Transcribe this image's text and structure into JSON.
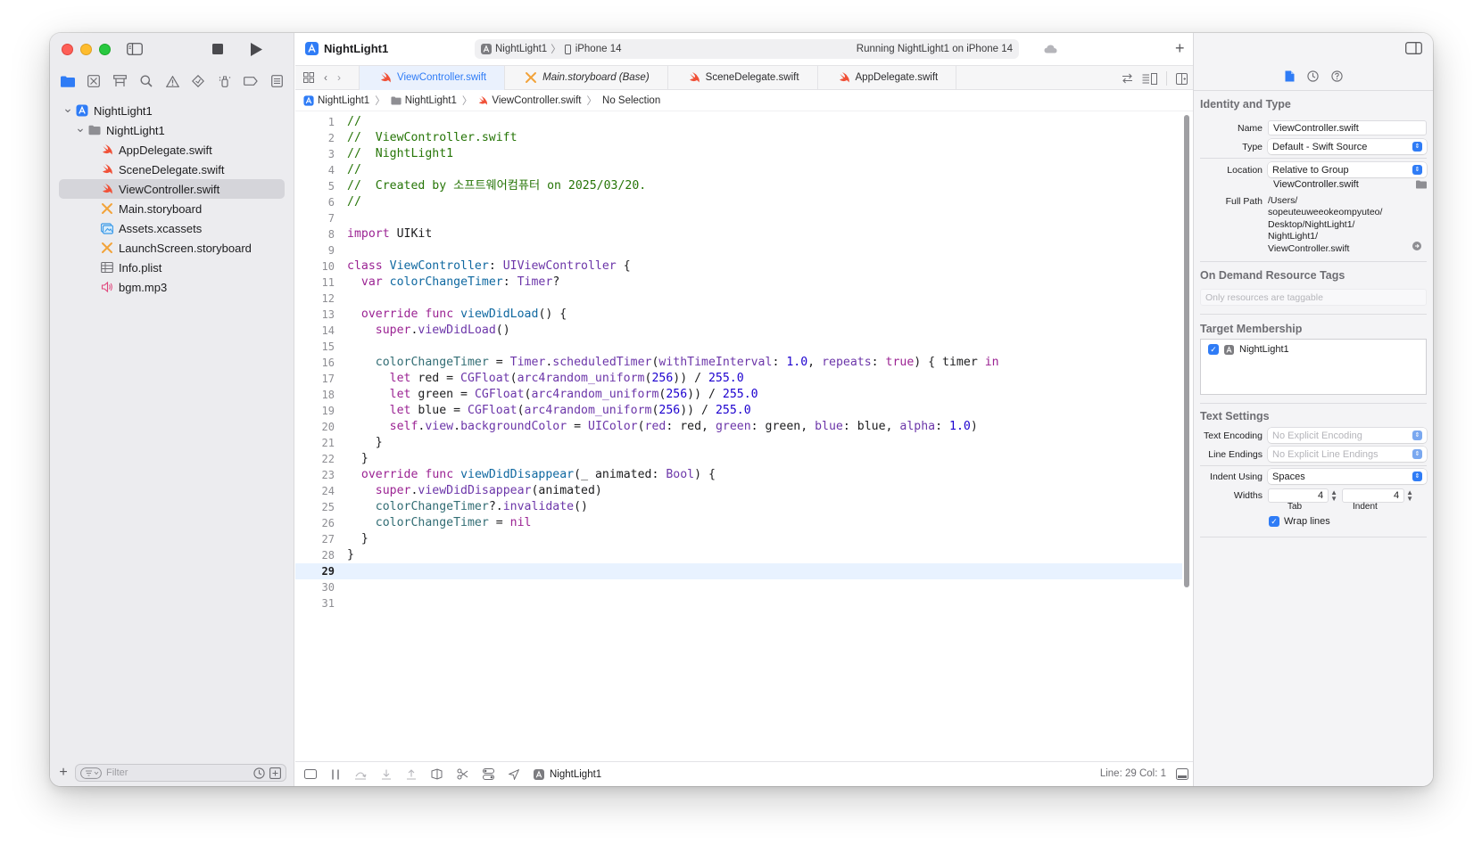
{
  "window": {
    "app_title": "NightLight1",
    "scheme_target": "NightLight1",
    "scheme_device": "iPhone 14",
    "run_status": "Running NightLight1 on iPhone 14"
  },
  "navigator": {
    "tree": [
      {
        "label": "NightLight1",
        "icon": "app-project-icon",
        "indent": 0,
        "chevron": "down",
        "selected": false
      },
      {
        "label": "NightLight1",
        "icon": "folder-icon",
        "indent": 1,
        "chevron": "down",
        "selected": false
      },
      {
        "label": "AppDelegate.swift",
        "icon": "swift-file-icon",
        "indent": 2,
        "chevron": "",
        "selected": false
      },
      {
        "label": "SceneDelegate.swift",
        "icon": "swift-file-icon",
        "indent": 2,
        "chevron": "",
        "selected": false
      },
      {
        "label": "ViewController.swift",
        "icon": "swift-file-icon",
        "indent": 2,
        "chevron": "",
        "selected": true
      },
      {
        "label": "Main.storyboard",
        "icon": "storyboard-icon",
        "indent": 2,
        "chevron": "",
        "selected": false
      },
      {
        "label": "Assets.xcassets",
        "icon": "assets-icon",
        "indent": 2,
        "chevron": "",
        "selected": false
      },
      {
        "label": "LaunchScreen.storyboard",
        "icon": "storyboard-icon",
        "indent": 2,
        "chevron": "",
        "selected": false
      },
      {
        "label": "Info.plist",
        "icon": "plist-icon",
        "indent": 2,
        "chevron": "",
        "selected": false
      },
      {
        "label": "bgm.mp3",
        "icon": "audio-file-icon",
        "indent": 2,
        "chevron": "",
        "selected": false
      }
    ],
    "filter_placeholder": "Filter"
  },
  "tabs": [
    {
      "label": "ViewController.swift",
      "icon": "swift-file-icon",
      "active": true,
      "italic": false
    },
    {
      "label": "Main.storyboard (Base)",
      "icon": "storyboard-icon",
      "active": false,
      "italic": true
    },
    {
      "label": "SceneDelegate.swift",
      "icon": "swift-file-icon",
      "active": false,
      "italic": false
    },
    {
      "label": "AppDelegate.swift",
      "icon": "swift-file-icon",
      "active": false,
      "italic": false
    }
  ],
  "jumpbar": [
    "NightLight1",
    "NightLight1",
    "ViewController.swift",
    "No Selection"
  ],
  "code": {
    "current_line": 29,
    "lines": [
      [
        [
          "c",
          "//"
        ]
      ],
      [
        [
          "c",
          "//  ViewController.swift"
        ]
      ],
      [
        [
          "c",
          "//  NightLight1"
        ]
      ],
      [
        [
          "c",
          "//"
        ]
      ],
      [
        [
          "c",
          "//  Created by 소프트웨어컴퓨터 on 2025/03/20."
        ]
      ],
      [
        [
          "c",
          "//"
        ]
      ],
      [],
      [
        [
          "k",
          "import"
        ],
        [
          "p",
          " UIKit"
        ]
      ],
      [],
      [
        [
          "k",
          "class"
        ],
        [
          "p",
          " "
        ],
        [
          "d",
          "ViewController"
        ],
        [
          "p",
          ": "
        ],
        [
          "t",
          "UIViewController"
        ],
        [
          "p",
          " {"
        ]
      ],
      [
        [
          "p",
          "  "
        ],
        [
          "k",
          "var"
        ],
        [
          "p",
          " "
        ],
        [
          "d",
          "colorChangeTimer"
        ],
        [
          "p",
          ": "
        ],
        [
          "t",
          "Timer"
        ],
        [
          "p",
          "?"
        ]
      ],
      [],
      [
        [
          "p",
          "  "
        ],
        [
          "k",
          "override"
        ],
        [
          "p",
          " "
        ],
        [
          "k",
          "func"
        ],
        [
          "p",
          " "
        ],
        [
          "d",
          "viewDidLoad"
        ],
        [
          "p",
          "() {"
        ]
      ],
      [
        [
          "p",
          "    "
        ],
        [
          "k",
          "super"
        ],
        [
          "p",
          "."
        ],
        [
          "t",
          "viewDidLoad"
        ],
        [
          "p",
          "()"
        ]
      ],
      [],
      [
        [
          "p",
          "    "
        ],
        [
          "i",
          "colorChangeTimer"
        ],
        [
          "p",
          " = "
        ],
        [
          "t",
          "Timer"
        ],
        [
          "p",
          "."
        ],
        [
          "t",
          "scheduledTimer"
        ],
        [
          "p",
          "("
        ],
        [
          "t",
          "withTimeInterval"
        ],
        [
          "p",
          ": "
        ],
        [
          "n",
          "1.0"
        ],
        [
          "p",
          ", "
        ],
        [
          "t",
          "repeats"
        ],
        [
          "p",
          ": "
        ],
        [
          "k",
          "true"
        ],
        [
          "p",
          ") { timer "
        ],
        [
          "k",
          "in"
        ]
      ],
      [
        [
          "p",
          "      "
        ],
        [
          "k",
          "let"
        ],
        [
          "p",
          " red = "
        ],
        [
          "t",
          "CGFloat"
        ],
        [
          "p",
          "("
        ],
        [
          "t",
          "arc4random_uniform"
        ],
        [
          "p",
          "("
        ],
        [
          "n",
          "256"
        ],
        [
          "p",
          ")) / "
        ],
        [
          "n",
          "255.0"
        ]
      ],
      [
        [
          "p",
          "      "
        ],
        [
          "k",
          "let"
        ],
        [
          "p",
          " green = "
        ],
        [
          "t",
          "CGFloat"
        ],
        [
          "p",
          "("
        ],
        [
          "t",
          "arc4random_uniform"
        ],
        [
          "p",
          "("
        ],
        [
          "n",
          "256"
        ],
        [
          "p",
          ")) / "
        ],
        [
          "n",
          "255.0"
        ]
      ],
      [
        [
          "p",
          "      "
        ],
        [
          "k",
          "let"
        ],
        [
          "p",
          " blue = "
        ],
        [
          "t",
          "CGFloat"
        ],
        [
          "p",
          "("
        ],
        [
          "t",
          "arc4random_uniform"
        ],
        [
          "p",
          "("
        ],
        [
          "n",
          "256"
        ],
        [
          "p",
          ")) / "
        ],
        [
          "n",
          "255.0"
        ]
      ],
      [
        [
          "p",
          "      "
        ],
        [
          "k",
          "self"
        ],
        [
          "p",
          "."
        ],
        [
          "t",
          "view"
        ],
        [
          "p",
          "."
        ],
        [
          "t",
          "backgroundColor"
        ],
        [
          "p",
          " = "
        ],
        [
          "t",
          "UIColor"
        ],
        [
          "p",
          "("
        ],
        [
          "t",
          "red"
        ],
        [
          "p",
          ": red, "
        ],
        [
          "t",
          "green"
        ],
        [
          "p",
          ": green, "
        ],
        [
          "t",
          "blue"
        ],
        [
          "p",
          ": blue, "
        ],
        [
          "t",
          "alpha"
        ],
        [
          "p",
          ": "
        ],
        [
          "n",
          "1.0"
        ],
        [
          "p",
          ")"
        ]
      ],
      [
        [
          "p",
          "    }"
        ]
      ],
      [
        [
          "p",
          "  }"
        ]
      ],
      [
        [
          "p",
          "  "
        ],
        [
          "k",
          "override"
        ],
        [
          "p",
          " "
        ],
        [
          "k",
          "func"
        ],
        [
          "p",
          " "
        ],
        [
          "d",
          "viewDidDisappear"
        ],
        [
          "p",
          "(_ animated: "
        ],
        [
          "t",
          "Bool"
        ],
        [
          "p",
          ") {"
        ]
      ],
      [
        [
          "p",
          "    "
        ],
        [
          "k",
          "super"
        ],
        [
          "p",
          "."
        ],
        [
          "t",
          "viewDidDisappear"
        ],
        [
          "p",
          "(animated)"
        ]
      ],
      [
        [
          "p",
          "    "
        ],
        [
          "i",
          "colorChangeTimer"
        ],
        [
          "p",
          "?."
        ],
        [
          "t",
          "invalidate"
        ],
        [
          "p",
          "()"
        ]
      ],
      [
        [
          "p",
          "    "
        ],
        [
          "i",
          "colorChangeTimer"
        ],
        [
          "p",
          " = "
        ],
        [
          "k",
          "nil"
        ]
      ],
      [
        [
          "p",
          "  }"
        ]
      ],
      [
        [
          "p",
          "}"
        ]
      ],
      [],
      [],
      []
    ]
  },
  "statusbar": {
    "target": "NightLight1",
    "position": "Line: 29  Col: 1"
  },
  "inspector": {
    "identity_title": "Identity and Type",
    "name_label": "Name",
    "name_value": "ViewController.swift",
    "type_label": "Type",
    "type_value": "Default - Swift Source",
    "location_label": "Location",
    "location_value": "Relative to Group",
    "location_file": "ViewController.swift",
    "fullpath_label": "Full Path",
    "fullpath_lines": [
      "/Users/",
      "sopeuteuweeokeompyuteo/",
      "Desktop/NightLight1/",
      "NightLight1/",
      "ViewController.swift"
    ],
    "odr_title": "On Demand Resource Tags",
    "odr_placeholder": "Only resources are taggable",
    "membership_title": "Target Membership",
    "membership_target": "NightLight1",
    "text_title": "Text Settings",
    "encoding_label": "Text Encoding",
    "encoding_value": "No Explicit Encoding",
    "endings_label": "Line Endings",
    "endings_value": "No Explicit Line Endings",
    "indent_label": "Indent Using",
    "indent_value": "Spaces",
    "widths_label": "Widths",
    "tab_width": "4",
    "indent_width": "4",
    "tab_caption": "Tab",
    "indent_caption": "Indent",
    "wrap_label": "Wrap lines"
  },
  "colors": {
    "accent": "#2f7cf6",
    "keyword": "#9b2393",
    "comment": "#267507",
    "declaration": "#0f68a0",
    "type_call": "#6c36a9",
    "number": "#1c00cf",
    "ivar": "#326d74",
    "swift": "#f05138",
    "storyboard": "#f2a33a"
  }
}
